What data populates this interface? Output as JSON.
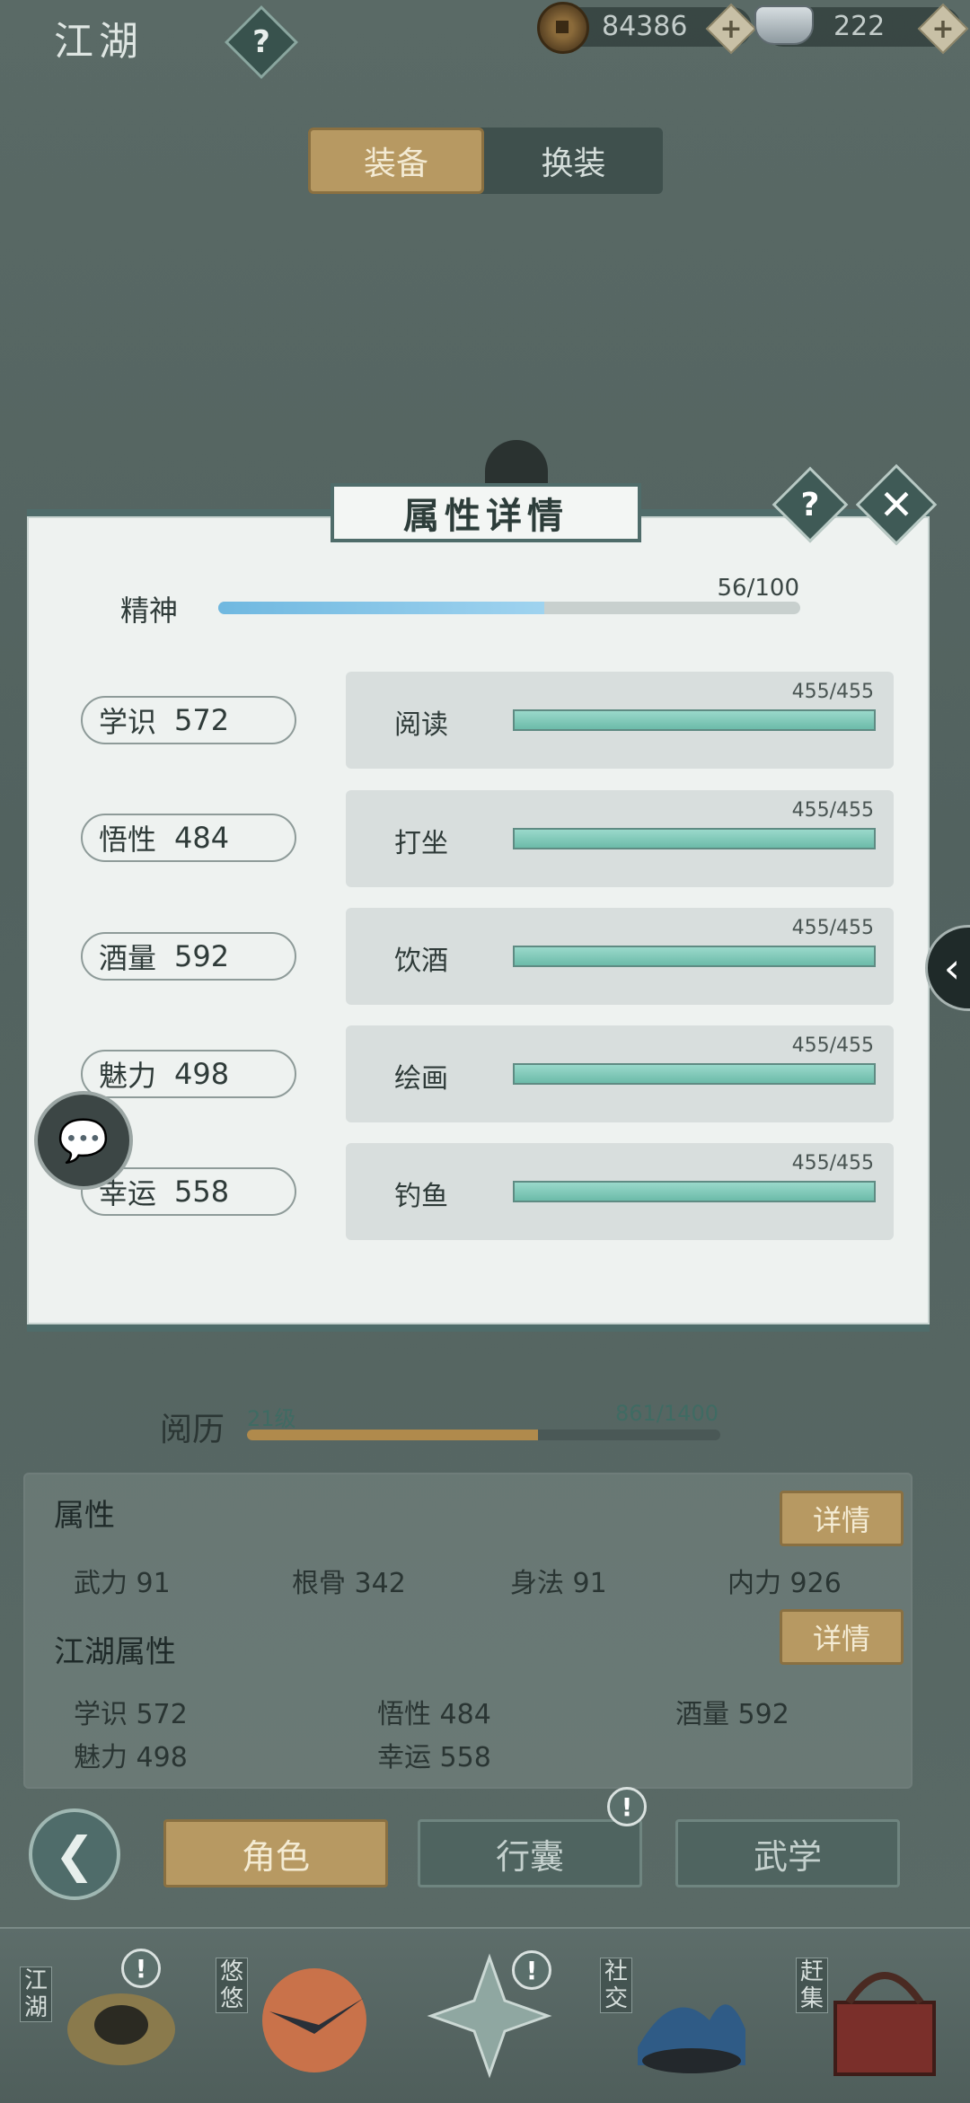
{
  "topbar": {
    "title": "江湖",
    "help": "?",
    "coins": "84386",
    "silver": "222",
    "plus": "+"
  },
  "tabs": {
    "equip": "装备",
    "change": "换装"
  },
  "modal": {
    "title": "属性详情",
    "help": "?",
    "close": "✕",
    "spirit": {
      "label": "精神",
      "value": "56/100",
      "fraction": 0.56
    },
    "rows": [
      {
        "attr": "学识",
        "attr_value": "572",
        "skill": "阅读",
        "skill_value": "455/455",
        "fraction": 1.0
      },
      {
        "attr": "悟性",
        "attr_value": "484",
        "skill": "打坐",
        "skill_value": "455/455",
        "fraction": 1.0
      },
      {
        "attr": "酒量",
        "attr_value": "592",
        "skill": "饮酒",
        "skill_value": "455/455",
        "fraction": 1.0
      },
      {
        "attr": "魅力",
        "attr_value": "498",
        "skill": "绘画",
        "skill_value": "455/455",
        "fraction": 1.0
      },
      {
        "attr": "幸运",
        "attr_value": "558",
        "skill": "钓鱼",
        "skill_value": "455/455",
        "fraction": 1.0
      }
    ]
  },
  "experience": {
    "label": "阅历",
    "level": "21级",
    "value": "861/1400",
    "fraction": 0.615
  },
  "attributes": {
    "title": "属性",
    "detail": "详情",
    "stats": [
      {
        "label": "武力",
        "value": "91"
      },
      {
        "label": "根骨",
        "value": "342"
      },
      {
        "label": "身法",
        "value": "91"
      },
      {
        "label": "内力",
        "value": "926"
      }
    ]
  },
  "jianghu_attributes": {
    "title": "江湖属性",
    "detail": "详情",
    "stats": [
      {
        "label": "学识",
        "value": "572"
      },
      {
        "label": "悟性",
        "value": "484"
      },
      {
        "label": "酒量",
        "value": "592"
      },
      {
        "label": "魅力",
        "value": "498"
      },
      {
        "label": "幸运",
        "value": "558"
      }
    ]
  },
  "nav": {
    "back": "❮",
    "tabs": [
      "角色",
      "行囊",
      "武学"
    ],
    "alert": "!"
  },
  "bottom": {
    "items": [
      "江湖",
      "悠悠",
      "社交",
      "赶集"
    ]
  },
  "colors": {
    "accent_gold": "#b79962",
    "teal_dark": "#4f6c6a",
    "spirit_bar": "#6fb8e0",
    "skill_bar": "#6cbba9",
    "exp_bar": "#b08a4c"
  }
}
